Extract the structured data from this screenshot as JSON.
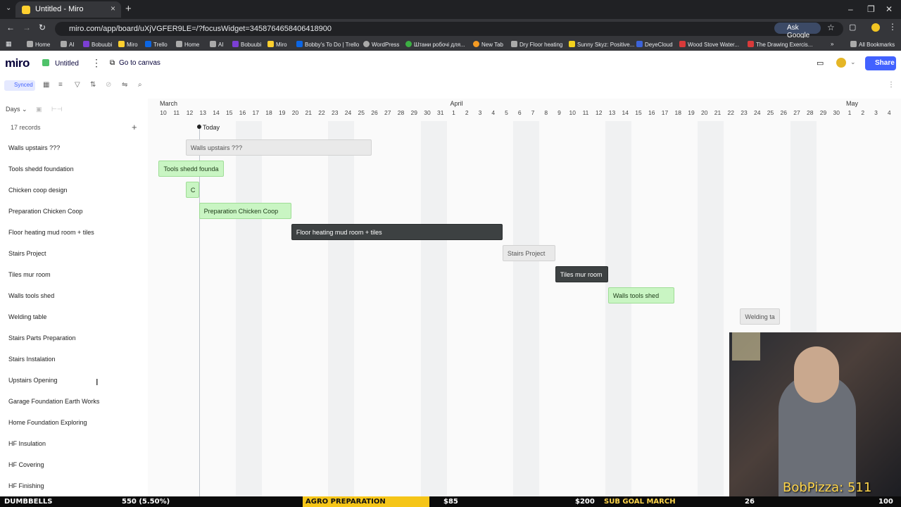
{
  "browser": {
    "tab_title": "Untitled - Miro",
    "url": "miro.com/app/board/uXjVGFER9LE=/?focusWidget=3458764658406418900",
    "ask_google": "Ask Google",
    "all_bookmarks": "All Bookmarks",
    "bookmarks": [
      "Home",
      "AI",
      "Bobuubi",
      "Miro",
      "Trello",
      "Home",
      "AI",
      "Bobuubi",
      "Miro",
      "Bobby's To Do | Trello",
      "WordPress",
      "Штани робочі для...",
      "New Tab",
      "Dry Floor heating",
      "Sunny Skyz: Positive...",
      "DeyeCloud",
      "Wood Stove Water...",
      "The Drawing Exercis..."
    ]
  },
  "app": {
    "logo": "miro",
    "board_title": "Untitled",
    "go_to_canvas": "Go to canvas",
    "share": "Share",
    "synced": "Synced"
  },
  "timeline": {
    "scale": "Days",
    "records": "17 records",
    "today": "Today",
    "months": [
      {
        "label": "March"
      },
      {
        "label": "April"
      },
      {
        "label": "May"
      }
    ],
    "days": [
      "10",
      "11",
      "12",
      "13",
      "14",
      "15",
      "16",
      "17",
      "18",
      "19",
      "20",
      "21",
      "22",
      "23",
      "24",
      "25",
      "26",
      "27",
      "28",
      "29",
      "30",
      "31",
      "1",
      "2",
      "3",
      "4",
      "5",
      "6",
      "7",
      "8",
      "9",
      "10",
      "11",
      "12",
      "13",
      "14",
      "15",
      "16",
      "17",
      "18",
      "19",
      "20",
      "21",
      "22",
      "23",
      "24",
      "25",
      "26",
      "27",
      "28",
      "29",
      "30",
      "1",
      "2",
      "3",
      "4"
    ],
    "rows": [
      "Walls upstairs ???",
      "Tools shedd foundation",
      "Chicken coop design",
      "Preparation Chicken Coop",
      "Floor heating mud room  + tiles",
      "Stairs Project",
      "Tiles mur room",
      "Walls tools shed",
      "Welding table",
      "Stairs Parts Preparation",
      "Stairs Instalation",
      "Upstairs Opening",
      "Garage Foundation Earth Works",
      "Home Foundation Exploring",
      "HF Insulation",
      "HF Covering",
      "HF Finishing"
    ],
    "bars": [
      {
        "label": "Walls upstairs ???",
        "style": "gray"
      },
      {
        "label": "Tools shedd founda",
        "style": "green"
      },
      {
        "label": "C",
        "style": "green"
      },
      {
        "label": "Preparation Chicken Coop",
        "style": "green"
      },
      {
        "label": "Floor heating mud room  + tiles",
        "style": "dark"
      },
      {
        "label": "Stairs Project",
        "style": "gray"
      },
      {
        "label": "Tiles mur room",
        "style": "dark"
      },
      {
        "label": "Walls tools shed",
        "style": "green"
      },
      {
        "label": "Welding ta",
        "style": "gray"
      }
    ]
  },
  "overlay": {
    "cam_name": "BobPizza: 511",
    "ticker": [
      "DUMBBELLS",
      "550 (5.50%)",
      "AGRO PREPARATION",
      "$85",
      "$200",
      "SUB GOAL MARCH",
      "26",
      "100"
    ]
  }
}
